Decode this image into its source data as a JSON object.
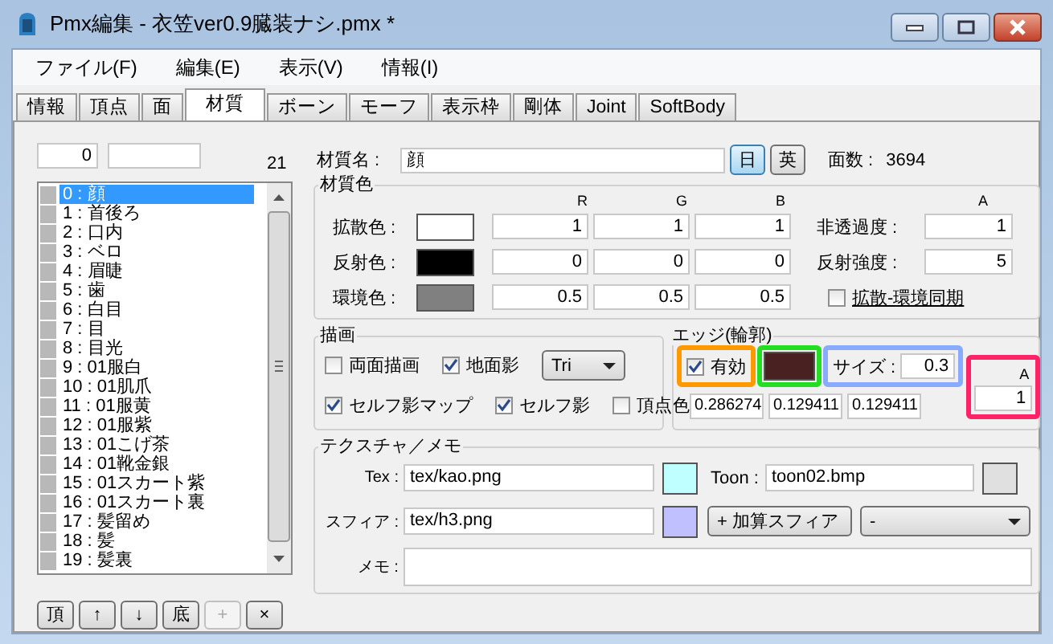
{
  "window": {
    "title": "Pmx編集 - 衣笠ver0.9臓装ナシ.pmx *"
  },
  "menu": [
    "ファイル(F)",
    "編集(E)",
    "表示(V)",
    "情報(I)"
  ],
  "tabs": [
    {
      "label": "情報",
      "selected": false
    },
    {
      "label": "頂点",
      "selected": false
    },
    {
      "label": "面",
      "selected": false
    },
    {
      "label": "材質",
      "selected": true
    },
    {
      "label": "ボーン",
      "selected": false
    },
    {
      "label": "モーフ",
      "selected": false
    },
    {
      "label": "表示枠",
      "selected": false
    },
    {
      "label": "剛体",
      "selected": false
    },
    {
      "label": "Joint",
      "selected": false
    },
    {
      "label": "SoftBody",
      "selected": false
    }
  ],
  "material_list": {
    "index": "0",
    "count": "21",
    "items": [
      {
        "label": "0 : 顔",
        "selected": true
      },
      {
        "label": "1 : 首後ろ",
        "selected": false
      },
      {
        "label": "2 : 口内",
        "selected": false
      },
      {
        "label": "3 : ベロ",
        "selected": false
      },
      {
        "label": "4 : 眉睫",
        "selected": false
      },
      {
        "label": "5 : 歯",
        "selected": false
      },
      {
        "label": "6 : 白目",
        "selected": false
      },
      {
        "label": "7 : 目",
        "selected": false
      },
      {
        "label": "8 : 目光",
        "selected": false
      },
      {
        "label": "9 : 01服白",
        "selected": false
      },
      {
        "label": "10 : 01肌爪",
        "selected": false
      },
      {
        "label": "11 : 01服黄",
        "selected": false
      },
      {
        "label": "12 : 01服紫",
        "selected": false
      },
      {
        "label": "13 : 01こげ茶",
        "selected": false
      },
      {
        "label": "14 : 01靴金銀",
        "selected": false
      },
      {
        "label": "15 : 01スカート紫",
        "selected": false
      },
      {
        "label": "16 : 01スカート裏",
        "selected": false
      },
      {
        "label": "17 : 髪留め",
        "selected": false
      },
      {
        "label": "18 : 髪",
        "selected": false
      },
      {
        "label": "19 : 髪裏",
        "selected": false
      }
    ],
    "buttons": [
      {
        "label": "頂",
        "disabled": false
      },
      {
        "label": "↑",
        "disabled": false
      },
      {
        "label": "↓",
        "disabled": false
      },
      {
        "label": "底",
        "disabled": false
      },
      {
        "label": "+",
        "disabled": true
      },
      {
        "label": "×",
        "disabled": false
      }
    ]
  },
  "material": {
    "name_label": "材質名 :",
    "name": "顔",
    "lang_buttons": [
      {
        "label": "日",
        "selected": true
      },
      {
        "label": "英",
        "selected": false
      }
    ],
    "face_count_label": "面数 :",
    "face_count": "3694"
  },
  "colors": {
    "title": "材質色",
    "headers": [
      "R",
      "G",
      "B"
    ],
    "alpha_header": "A",
    "rows": [
      {
        "kind": "field",
        "label": "拡散色 :",
        "color": "#ffffff",
        "values": [
          "1",
          "1",
          "1"
        ],
        "extra_label": "非透過度 :",
        "extra_value": "1"
      },
      {
        "kind": "field",
        "label": "反射色 :",
        "color": "#000000",
        "values": [
          "0",
          "0",
          "0"
        ],
        "extra_label": "反射強度 :",
        "extra_value": "5"
      },
      {
        "kind": "checkbox",
        "label": "環境色 :",
        "color": "#808080",
        "values": [
          "0.5",
          "0.5",
          "0.5"
        ],
        "extra_label": "拡散-環境同期",
        "checked": false
      }
    ]
  },
  "drawing": {
    "title": "描画",
    "options": [
      {
        "label": "両面描画",
        "checked": false
      },
      {
        "label": "地面影",
        "checked": true
      },
      {
        "label": "セルフ影マップ",
        "checked": true
      },
      {
        "label": "セルフ影",
        "checked": true
      },
      {
        "label": "頂点色",
        "checked": false
      }
    ],
    "mode": "Tri"
  },
  "edge": {
    "title": "エッジ(輪郭)",
    "highlights": [
      {
        "color": "#ff9900"
      },
      {
        "color": "#22dd22"
      },
      {
        "color": "#88aaff"
      },
      {
        "color": "#ff2266"
      }
    ],
    "enabled": {
      "label": "有効",
      "checked": true
    },
    "swatch": {
      "color": "#492121"
    },
    "size": {
      "label": "サイズ :",
      "value": "0.3"
    },
    "values": [
      "0.286274",
      "0.129411",
      "0.129411"
    ],
    "alpha": {
      "header": "A",
      "value": "1"
    }
  },
  "texture": {
    "title": "テクスチャ／メモ",
    "swatches": [
      {
        "color": "#c0ffff"
      },
      {
        "color": "#e0e0e0"
      },
      {
        "color": "#c0c0ff"
      }
    ],
    "tex": {
      "label": "Tex :",
      "value": "tex/kao.png"
    },
    "toon": {
      "label": "Toon :",
      "value": "toon02.bmp"
    },
    "sphere": {
      "label": "スフィア :",
      "value": "tex/h3.png",
      "mode": "+ 加算スフィア"
    },
    "toon_select": "-",
    "memo_label": "メモ :"
  }
}
